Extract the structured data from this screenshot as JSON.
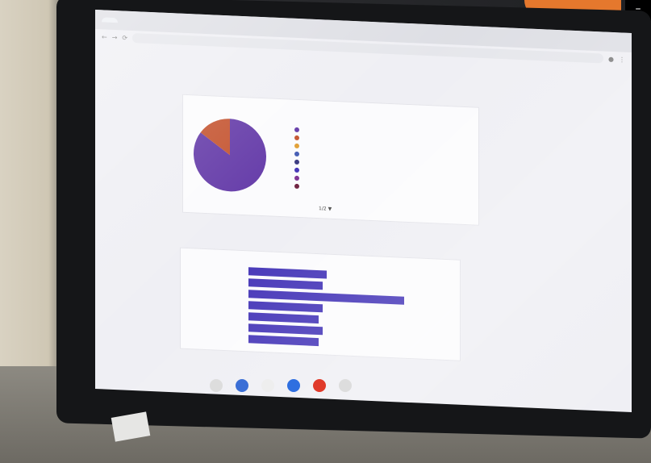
{
  "page": {
    "description_tag": ""
  },
  "browser": {
    "tabs": [
      ""
    ],
    "bookmarks": [
      "",
      "",
      "",
      "",
      ""
    ]
  },
  "pie_card": {
    "title": "",
    "subtitle": "",
    "legend_items": [
      {
        "label": "",
        "color": "#5b2fa3"
      },
      {
        "label": "",
        "color": "#c14a24"
      },
      {
        "label": "",
        "color": "#e09a2a"
      },
      {
        "label": "",
        "color": "#3a53b0"
      },
      {
        "label": "",
        "color": "#2f2f7a"
      },
      {
        "label": "",
        "color": "#3b2bb4"
      },
      {
        "label": "",
        "color": "#7a2b8f"
      },
      {
        "label": "",
        "color": "#6a1a3a"
      }
    ],
    "legend_more": "1/2 ▼"
  },
  "bar_card": {
    "title": "",
    "subtitle": "",
    "bars": [
      {
        "label": "",
        "value": 0.42
      },
      {
        "label": "",
        "value": 0.4
      },
      {
        "label": "",
        "value": 0.84
      },
      {
        "label": "",
        "value": 0.4
      },
      {
        "label": "",
        "value": 0.38
      },
      {
        "label": "",
        "value": 0.4
      },
      {
        "label": "",
        "value": 0.38
      }
    ]
  },
  "chart_data": {
    "type": "pie",
    "slices": [
      {
        "label": "",
        "value": 85,
        "color": "#5b2fa3"
      },
      {
        "label": "",
        "value": 15,
        "color": "#c14a24"
      }
    ]
  },
  "overlay": {
    "corner_button_label": "–"
  }
}
